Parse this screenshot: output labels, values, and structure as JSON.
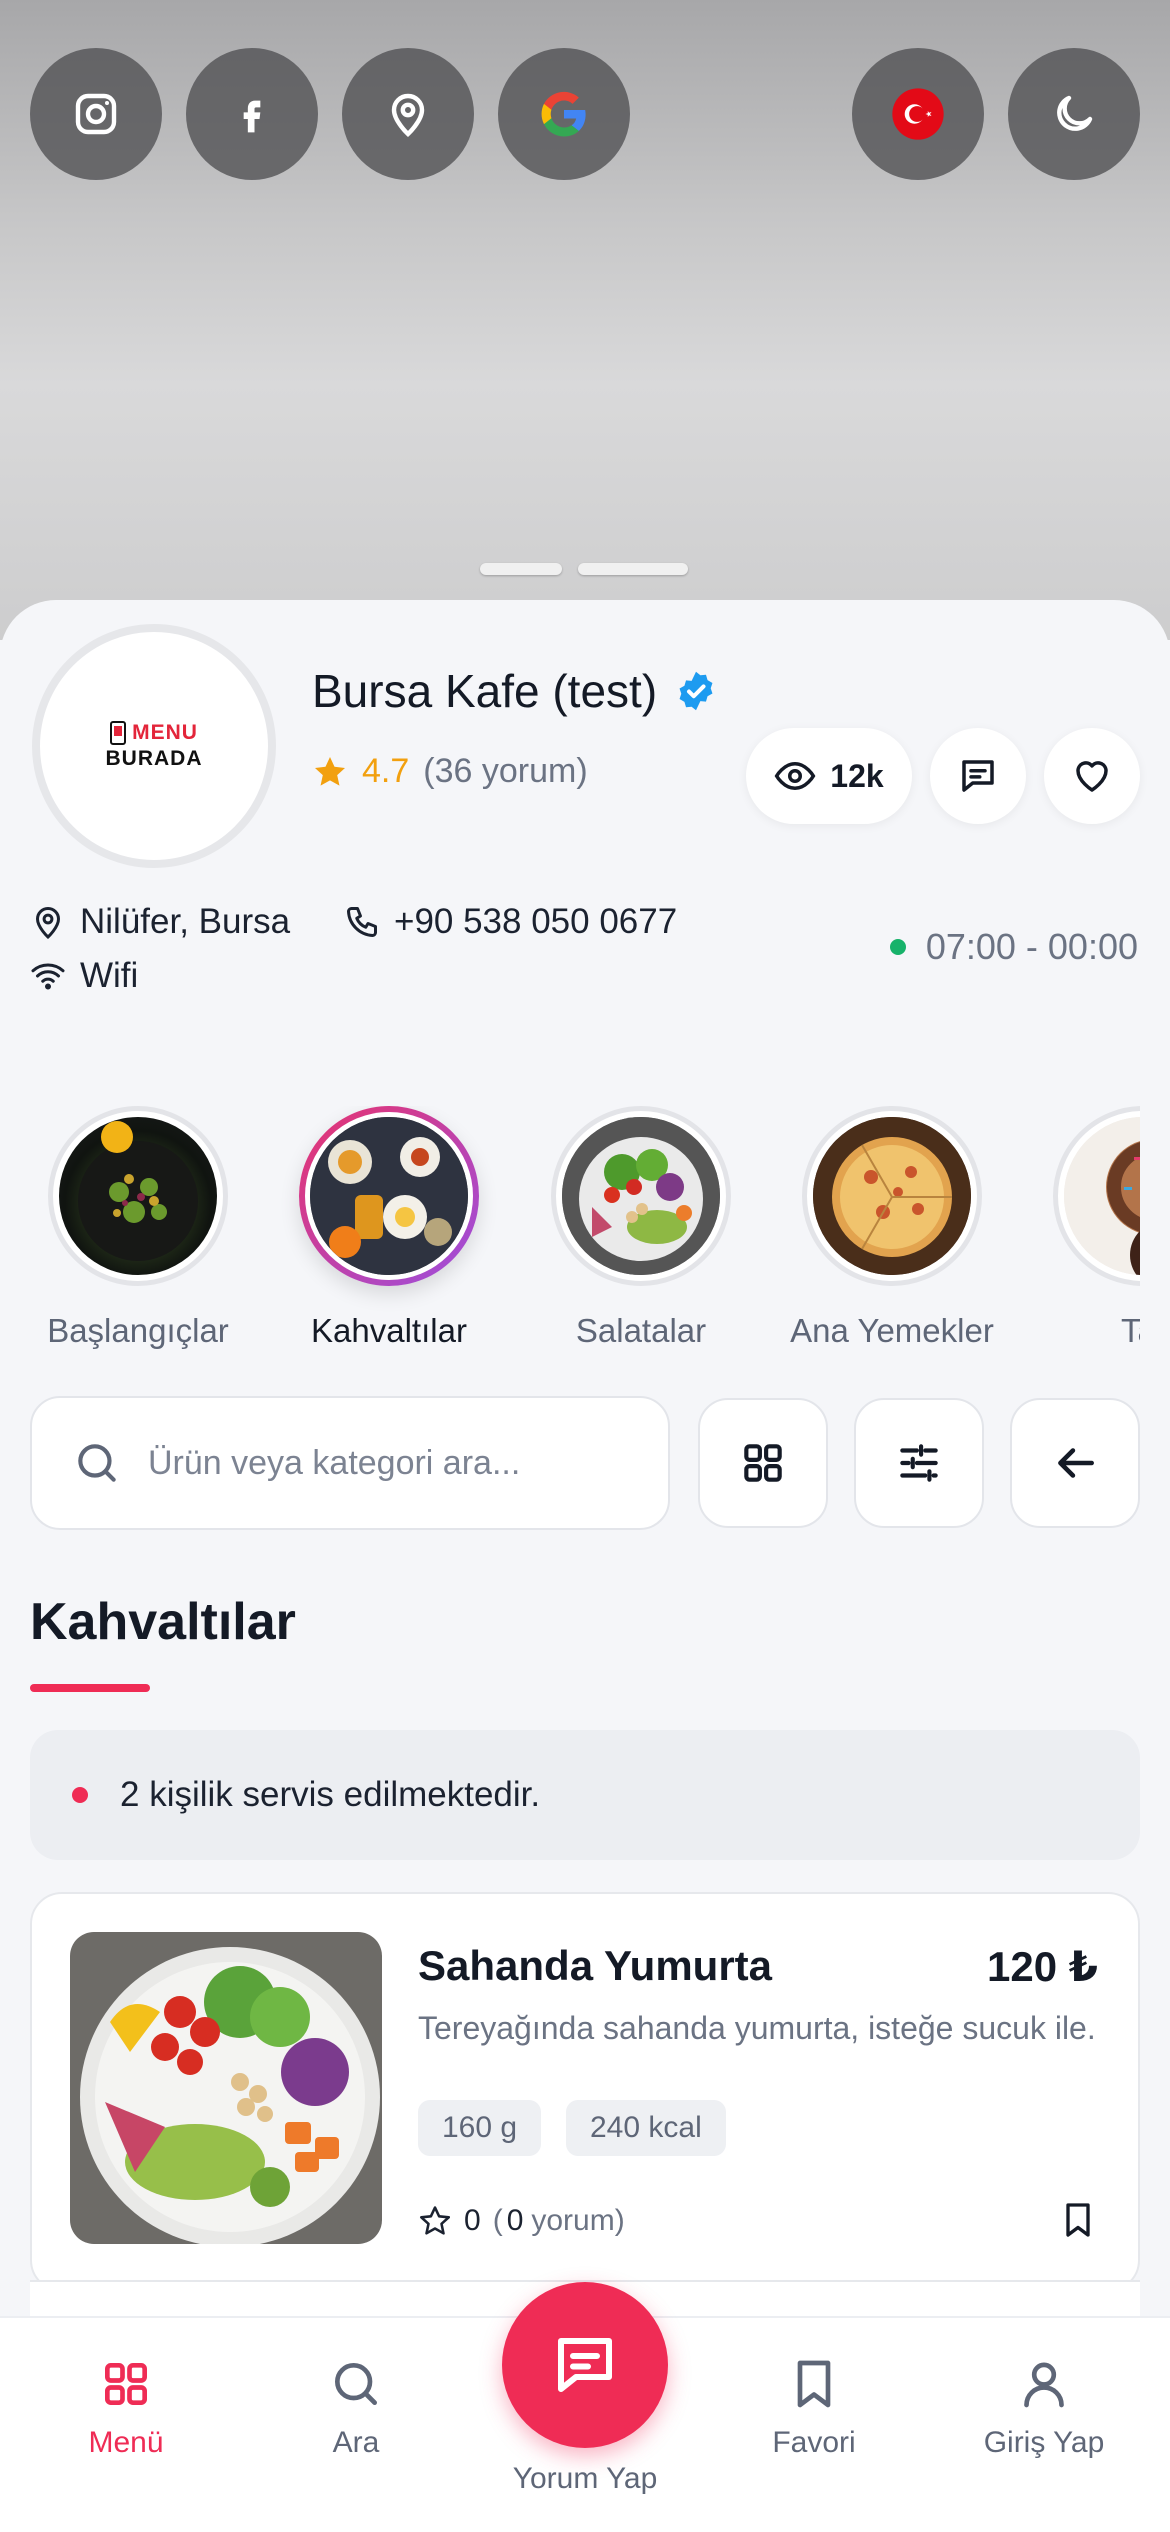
{
  "hero": {
    "social_buttons": [
      "instagram-icon",
      "facebook-icon",
      "location-icon",
      "google-icon"
    ],
    "language_flag": "turkey-flag-icon",
    "theme_toggle": "moon-icon"
  },
  "restaurant": {
    "logo_line1": "MENU",
    "logo_line2": "BURADA",
    "name": "Bursa Kafe (test)",
    "rating": "4.7",
    "reviews": "(36 yorum)",
    "views": "12k",
    "location": "Nilüfer, Bursa",
    "phone": "+90 538 050 0677",
    "wifi": "Wifi",
    "hours": "07:00 - 00:00"
  },
  "categories": [
    {
      "label": "Başlangıçlar",
      "active": false
    },
    {
      "label": "Kahvaltılar",
      "active": true
    },
    {
      "label": "Salatalar",
      "active": false
    },
    {
      "label": "Ana Yemekler",
      "active": false
    },
    {
      "label": "Tat",
      "active": false
    }
  ],
  "search": {
    "placeholder": "Ürün veya kategori ara..."
  },
  "section": {
    "title": "Kahvaltılar",
    "note": "2 kişilik servis edilmektedir."
  },
  "product": {
    "name": "Sahanda Yumurta",
    "price": "120 ₺",
    "description": "Tereyağında sahanda yumurta, isteğe sucuk ile.",
    "tags": [
      "160 g",
      "240 kcal"
    ],
    "rating": "0",
    "review_count": "0",
    "review_word": "yorum)",
    "review_open": "("
  },
  "nav": {
    "menu": "Menü",
    "search": "Ara",
    "review": "Yorum Yap",
    "favorites": "Favori",
    "login": "Giriş Yap"
  },
  "colors": {
    "accent": "#ef2c55",
    "star": "#f2a00f",
    "verified": "#1d9bf0",
    "open_status": "#17b26a"
  }
}
